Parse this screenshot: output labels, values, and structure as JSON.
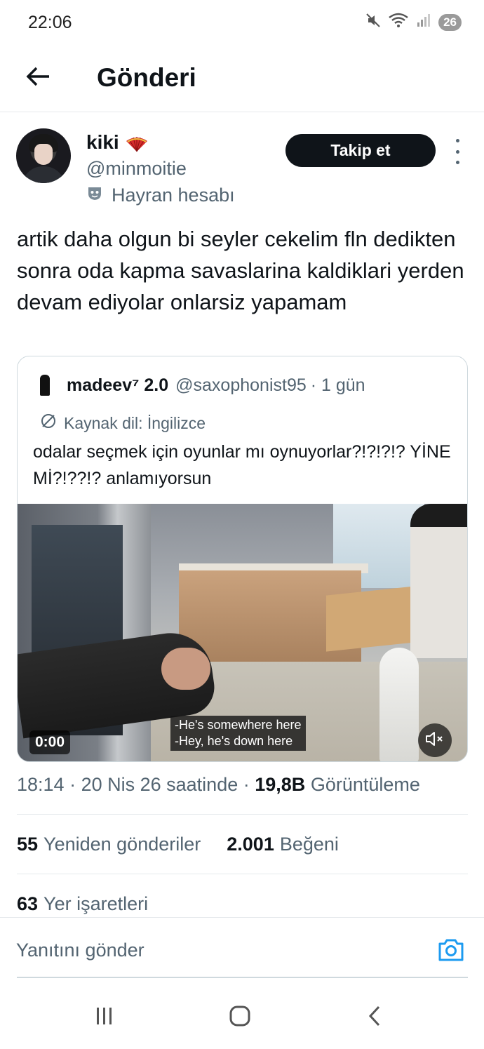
{
  "status_bar": {
    "time": "22:06",
    "battery": "26",
    "icons": [
      "mute-icon",
      "wifi-icon",
      "signal-icon"
    ]
  },
  "header": {
    "title": "Gönderi",
    "back_icon": "arrow-left-icon"
  },
  "author": {
    "name": "kiki",
    "emoji": "folding-fan-emoji",
    "handle": "@minmoitie",
    "label": "Hayran hesabı",
    "label_icon": "mask-icon",
    "follow_label": "Takip et"
  },
  "tweet": {
    "text": "artik daha olgun bi seyler cekelim fln dedikten sonra oda kapma savaslarina kaldiklari yerden devam ediyolar onlarsiz yapamam"
  },
  "quote": {
    "name": "madeev⁷ 2.0",
    "handle": "@saxophonist95",
    "time": "· 1 gün",
    "source_label": "Kaynak dil: İngilizce",
    "text": "odalar seçmek için oyunlar mı oynuyorlar?!?!?!? YİNE Mİ?!??!? anlamıyorsun",
    "video": {
      "duration": "0:00",
      "subtitle_line1": "-He's somewhere here",
      "subtitle_line2": "-Hey, he's down here",
      "mute_icon": "speaker-muted-icon"
    }
  },
  "meta": {
    "time": "18:14",
    "date": "· 20 Nis 26 saatinde ·",
    "views_count": "19,8B",
    "views_label": "Görüntüleme"
  },
  "stats": {
    "retweets_count": "55",
    "retweets_label": "Yeniden gönderiler",
    "likes_count": "2.001",
    "likes_label": "Beğeni",
    "bookmarks_count": "63",
    "bookmarks_label": "Yer işaretleri"
  },
  "reply": {
    "placeholder": "Yanıtını gönder",
    "camera_icon": "camera-icon"
  },
  "nav": [
    "recents-icon",
    "home-icon",
    "back-icon"
  ],
  "colors": {
    "text": "#0f1419",
    "secondary": "#536471",
    "accent": "#1d9bf0",
    "follow_bg": "#0f1419"
  }
}
